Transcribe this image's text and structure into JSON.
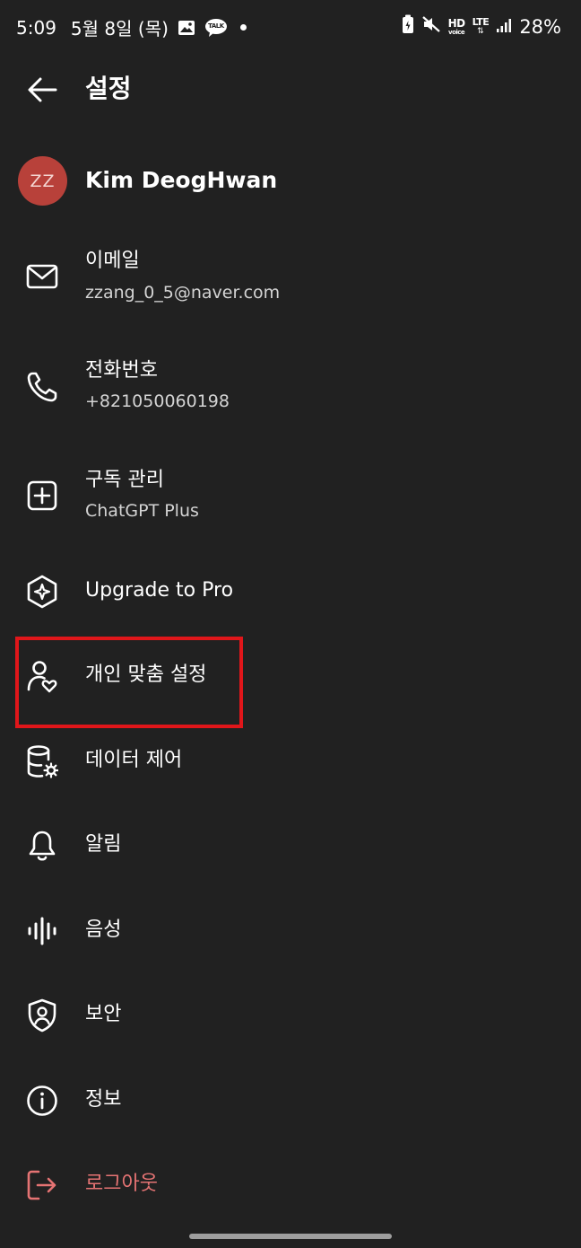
{
  "status_bar": {
    "time": "5:09",
    "date": "5월 8일 (목)",
    "talk_label": "TALK",
    "hd_label": "HD",
    "voice_label": "voice",
    "lte_label": "LTE",
    "battery": "28%"
  },
  "header": {
    "title": "설정"
  },
  "profile": {
    "initials": "ZZ",
    "name": "Kim DeogHwan",
    "avatar_color": "#b8413a"
  },
  "menu": {
    "email": {
      "label": "이메일",
      "value": "zzang_0_5@naver.com",
      "icon": "mail-icon"
    },
    "phone": {
      "label": "전화번호",
      "value": "+821050060198",
      "icon": "phone-icon"
    },
    "subscription": {
      "label": "구독 관리",
      "value": "ChatGPT Plus",
      "icon": "plus-square-icon"
    },
    "upgrade": {
      "label": "Upgrade to Pro",
      "icon": "sparkle-hexagon-icon"
    },
    "personalization": {
      "label": "개인 맞춤 설정",
      "icon": "user-heart-icon"
    },
    "data_controls": {
      "label": "데이터 제어",
      "icon": "database-gear-icon"
    },
    "notifications": {
      "label": "알림",
      "icon": "bell-icon"
    },
    "voice": {
      "label": "음성",
      "icon": "waveform-icon"
    },
    "security": {
      "label": "보안",
      "icon": "shield-user-icon"
    },
    "about": {
      "label": "정보",
      "icon": "info-icon"
    },
    "logout": {
      "label": "로그아웃",
      "icon": "logout-icon"
    }
  },
  "colors": {
    "background": "#212121",
    "text": "#ffffff",
    "secondary_text": "#d4d4d4",
    "logout": "#e57373",
    "highlight": "#e0161a"
  }
}
